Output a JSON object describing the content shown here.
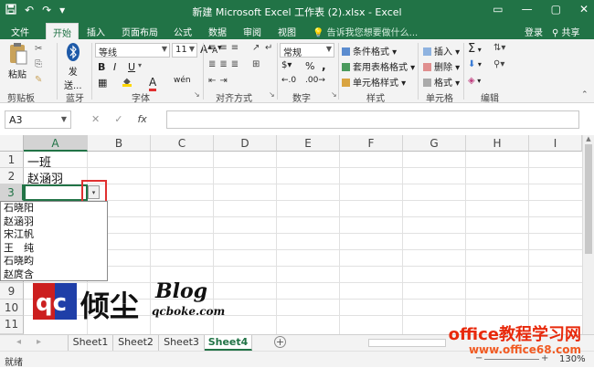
{
  "titlebar": {
    "title": "新建 Microsoft Excel 工作表 (2).xlsx - Excel",
    "save_icon": "save-icon",
    "undo_glyph": "↶",
    "redo_glyph": "↷",
    "qat_more_glyph": "▾",
    "ribbon_opts_glyph": "▭",
    "minimize_glyph": "—",
    "restore_glyph": "▢",
    "close_glyph": "✕",
    "bg_color": "#217346"
  },
  "tabs": {
    "items": [
      "文件",
      "开始",
      "插入",
      "页面布局",
      "公式",
      "数据",
      "审阅",
      "视图"
    ],
    "active": "开始",
    "tell_me": "告诉我您想要做什么...",
    "signin": "登录",
    "share": "共享"
  },
  "ribbon": {
    "clipboard": {
      "paste": "粘贴",
      "label": "剪贴板"
    },
    "bluetooth": {
      "send": "发",
      "send2": "送...",
      "label": "蓝牙"
    },
    "font": {
      "name": "等线",
      "size": "11",
      "bold": "B",
      "italic": "I",
      "underline": "U",
      "grow": "A",
      "shrink": "A",
      "font_color": "A",
      "wen": "wén",
      "label": "字体"
    },
    "align": {
      "label": "对齐方式"
    },
    "number": {
      "format": "常规",
      "percent": "%",
      "comma": ",",
      "label": "数字"
    },
    "styles": {
      "cond": "条件格式",
      "table": "套用表格格式",
      "cell": "单元格样式",
      "label": "样式"
    },
    "cells": {
      "insert": "插入",
      "delete": "删除",
      "format": "格式",
      "label": "单元格"
    },
    "editing": {
      "sigma": "Σ",
      "label": "编辑"
    }
  },
  "formula": {
    "namebox": "A3",
    "cancel": "✕",
    "enter": "✓",
    "fx": "fx",
    "value": ""
  },
  "grid": {
    "columns": [
      "A",
      "B",
      "C",
      "D",
      "E",
      "F",
      "G",
      "H",
      "I"
    ],
    "rows": [
      "1",
      "2",
      "3",
      "4",
      "5",
      "6",
      "7",
      "8",
      "9",
      "10",
      "11"
    ],
    "cells": {
      "A1": "一班",
      "A2": "赵涵羽",
      "A3": ""
    },
    "active_cell": "A3",
    "dropdown_glyph": "▾"
  },
  "dropdown": {
    "items": [
      "石晓阳",
      "赵涵羽",
      "宋江帆",
      "王　纯",
      "石晓昀",
      "赵庹含"
    ]
  },
  "sheets": {
    "tabs": [
      "Sheet1",
      "Sheet2",
      "Sheet3",
      "Sheet4"
    ],
    "active": "Sheet4",
    "add": "+",
    "nav_prev": "◂",
    "nav_next": "▸"
  },
  "status": {
    "ready": "就绪",
    "zoom": "130%",
    "zoom_minus": "−",
    "zoom_plus": "+"
  },
  "watermarks": {
    "logo_letters": "qc",
    "brand": "倾尘",
    "blog": "Blog",
    "blog_url": "qcboke.com",
    "site": "office教程学习网",
    "site_url": "www.office68.com"
  },
  "colors": {
    "accent": "#217346",
    "highlight": "#e03030",
    "watermark_red": "#e8290b",
    "watermark_orange": "#f15a22"
  }
}
